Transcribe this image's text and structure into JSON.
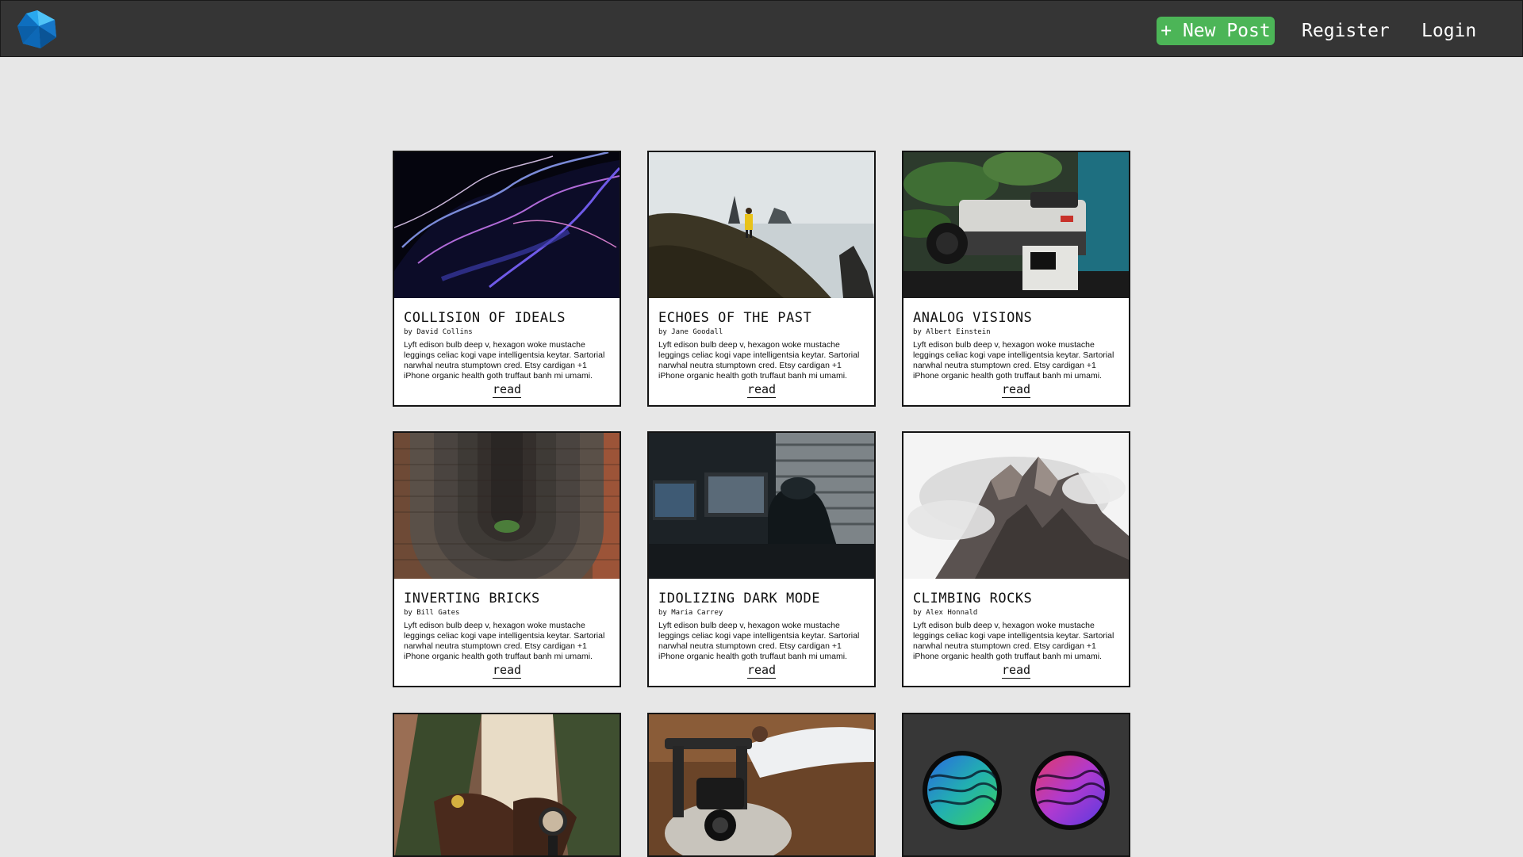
{
  "nav": {
    "new_post": "+ New Post",
    "register": "Register",
    "login": "Login"
  },
  "posts": [
    {
      "title": "COLLISION OF IDEALS",
      "author": "by David Collins",
      "excerpt": "Lyft edison bulb deep v, hexagon woke mustache leggings celiac kogi vape intelligentsia keytar. Sartorial narwhal neutra stumptown cred. Etsy cardigan +1 iPhone organic health goth truffaut banh mi umami.",
      "read": "read"
    },
    {
      "title": "ECHOES OF THE PAST",
      "author": "by Jane Goodall",
      "excerpt": "Lyft edison bulb deep v, hexagon woke mustache leggings celiac kogi vape intelligentsia keytar. Sartorial narwhal neutra stumptown cred. Etsy cardigan +1 iPhone organic health goth truffaut banh mi umami.",
      "read": "read"
    },
    {
      "title": "ANALOG VISIONS",
      "author": "by Albert Einstein",
      "excerpt": "Lyft edison bulb deep v, hexagon woke mustache leggings celiac kogi vape intelligentsia keytar. Sartorial narwhal neutra stumptown cred. Etsy cardigan +1 iPhone organic health goth truffaut banh mi umami.",
      "read": "read"
    },
    {
      "title": "INVERTING BRICKS",
      "author": "by Bill Gates",
      "excerpt": "Lyft edison bulb deep v, hexagon woke mustache leggings celiac kogi vape intelligentsia keytar. Sartorial narwhal neutra stumptown cred. Etsy cardigan +1 iPhone organic health goth truffaut banh mi umami.",
      "read": "read"
    },
    {
      "title": "IDOLIZING DARK MODE",
      "author": "by Maria Carrey",
      "excerpt": "Lyft edison bulb deep v, hexagon woke mustache leggings celiac kogi vape intelligentsia keytar. Sartorial narwhal neutra stumptown cred. Etsy cardigan +1 iPhone organic health goth truffaut banh mi umami.",
      "read": "read"
    },
    {
      "title": "CLIMBING ROCKS",
      "author": "by Alex Honnald",
      "excerpt": "Lyft edison bulb deep v, hexagon woke mustache leggings celiac kogi vape intelligentsia keytar. Sartorial narwhal neutra stumptown cred. Etsy cardigan +1 iPhone organic health goth truffaut banh mi umami.",
      "read": "read"
    }
  ],
  "colors": {
    "topbar": "#353535",
    "page_bg": "#e7e7e7",
    "new_post_bg": "#4cb557",
    "card_border": "#141414"
  },
  "icons": {
    "logo": "blue-polyhedron-logo-icon"
  }
}
